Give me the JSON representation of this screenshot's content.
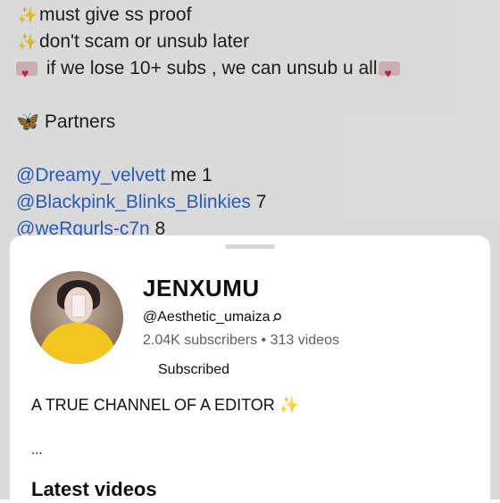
{
  "background_post": {
    "rules": [
      {
        "icon": "sparkles-icon",
        "text": "must give ss proof"
      },
      {
        "icon": "sparkles-icon",
        "text": "don't scam or unsub later"
      },
      {
        "icon": "heart-icon",
        "text": "if we lose 10+ subs , we can unsub u all"
      }
    ],
    "partners_heading": "Partners",
    "partners": [
      {
        "handle": "@Dreamy_velvett",
        "note": "me 1"
      },
      {
        "handle": "@Blackpink_Blinks_Blinkies",
        "note": "7"
      },
      {
        "handle": "@weRgurls-c7n",
        "note": "8"
      }
    ]
  },
  "channel_sheet": {
    "name": "JENXUMU",
    "handle": "@Aesthetic_umaiza",
    "subscribers": "2.04K subscribers",
    "separator": "•",
    "videos": "313 videos",
    "subscribe_state": "Subscribed",
    "description": "A TRUE CHANNEL OF A EDITOR",
    "description_more": "...",
    "latest_videos_heading": "Latest videos"
  },
  "colors": {
    "link": "#3366cc",
    "sparkle": "#e6b800",
    "heart": "#d22c4f"
  }
}
